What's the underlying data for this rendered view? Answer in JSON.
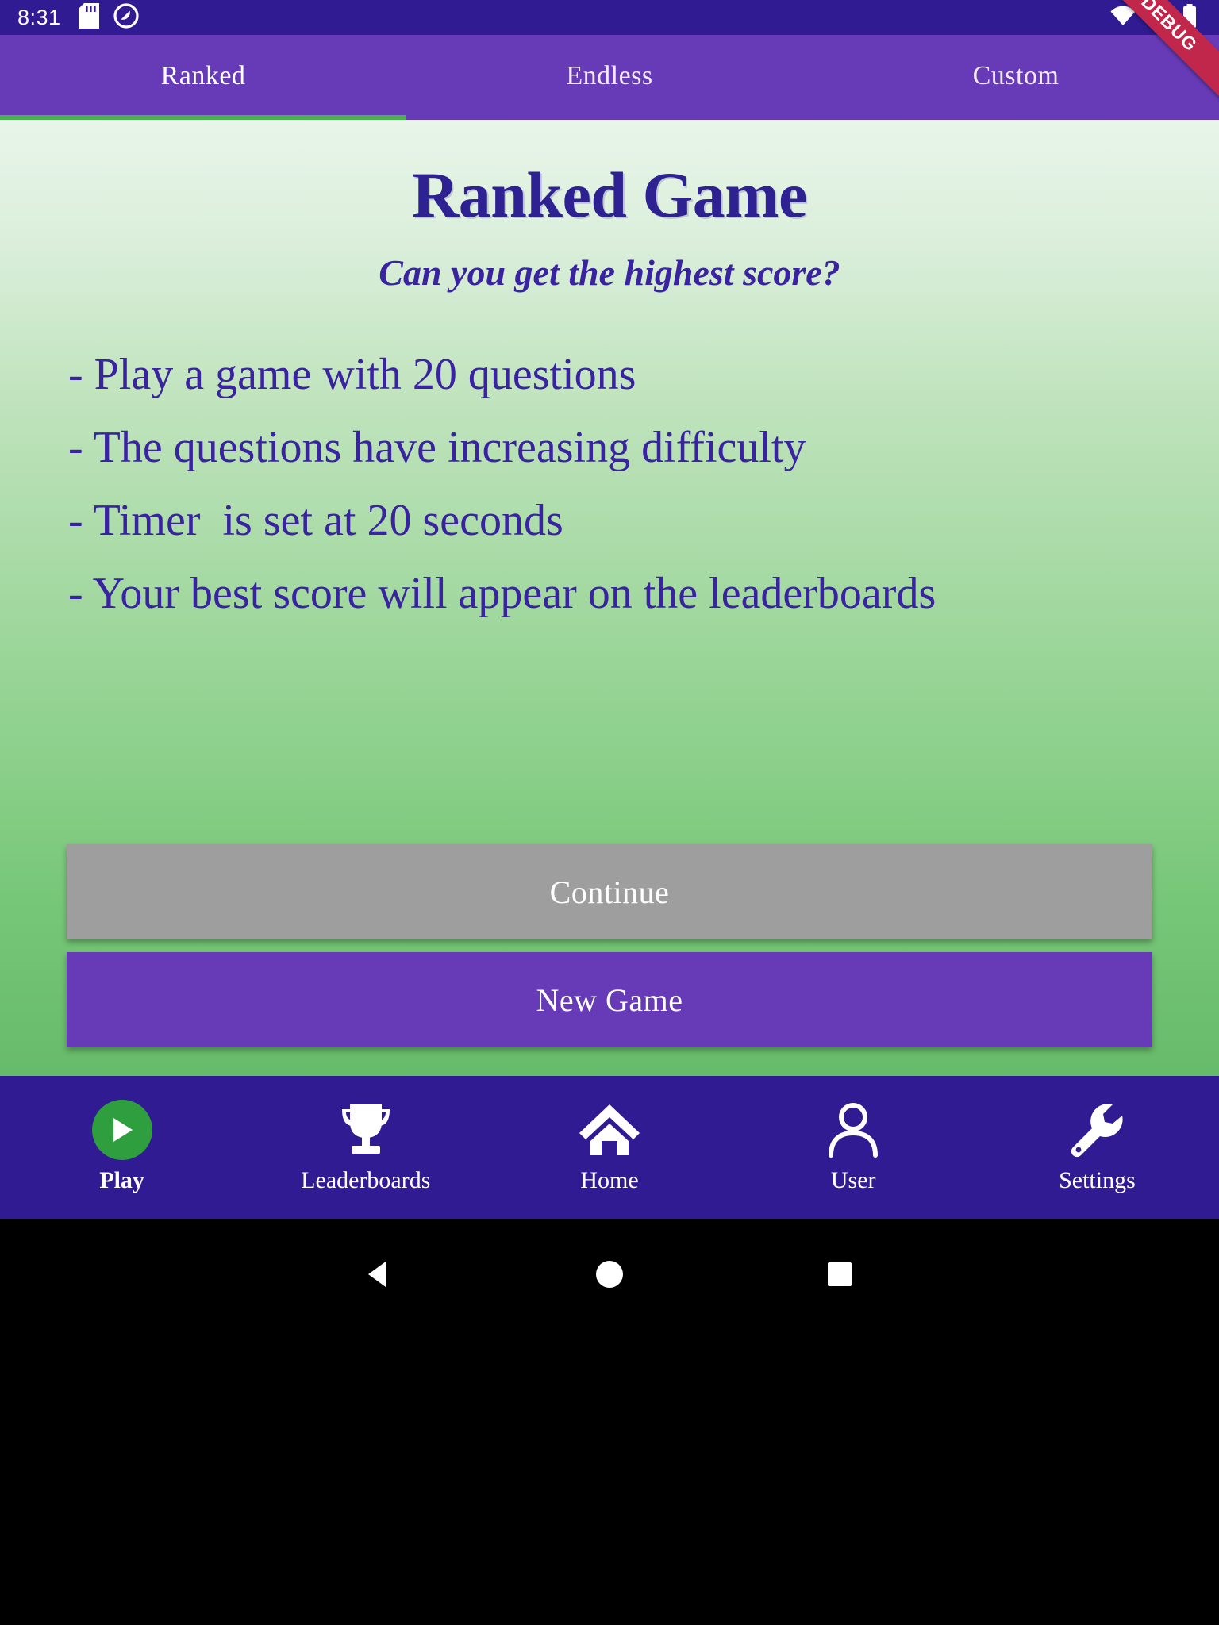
{
  "status_bar": {
    "time": "8:31",
    "icons": [
      "sd-card-icon",
      "do-not-disturb-icon",
      "wifi-icon",
      "cellular-signal-icon",
      "battery-icon"
    ]
  },
  "debug_banner": {
    "label": "DEBUG",
    "color": "#C1274B"
  },
  "tabs": [
    {
      "label": "Ranked",
      "active": true
    },
    {
      "label": "Endless",
      "active": false
    },
    {
      "label": "Custom",
      "active": false
    }
  ],
  "page": {
    "title": "Ranked Game",
    "subtitle": "Can you get the highest score?",
    "bullets": [
      "- Play a game with 20 questions",
      "- The questions have increasing difficulty",
      "- Timer  is set at 20 seconds",
      "- Your best score will appear on the leaderboards"
    ]
  },
  "buttons": {
    "continue": {
      "label": "Continue",
      "color": "#9E9E9E",
      "enabled": false
    },
    "new_game": {
      "label": "New Game",
      "color": "#673AB7",
      "enabled": true
    }
  },
  "bottom_nav": [
    {
      "label": "Play",
      "icon": "play-icon",
      "active": true
    },
    {
      "label": "Leaderboards",
      "icon": "trophy-icon",
      "active": false
    },
    {
      "label": "Home",
      "icon": "home-icon",
      "active": false
    },
    {
      "label": "User",
      "icon": "person-icon",
      "active": false
    },
    {
      "label": "Settings",
      "icon": "wrench-icon",
      "active": false
    }
  ],
  "system_nav": {
    "back": "back-triangle-icon",
    "home": "home-circle-icon",
    "recents": "recents-square-icon"
  },
  "colors": {
    "status_bar": "#311B92",
    "tab_bar": "#673AB7",
    "tab_indicator": "#4CAF50",
    "heading_text": "#2E2191",
    "body_text": "#3A23A0",
    "nav_bar": "#311B92",
    "play_accent": "#2E9E3E"
  }
}
